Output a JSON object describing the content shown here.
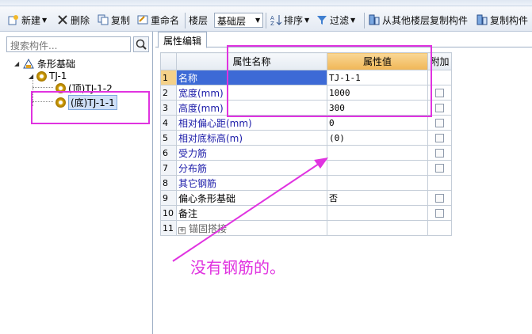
{
  "toolbar": {
    "new_label": "新建",
    "delete_label": "删除",
    "copy_label": "复制",
    "rename_label": "重命名",
    "floor_label": "楼层",
    "floor_value": "基础层",
    "sort_label": "排序",
    "filter_label": "过滤",
    "copy_from_floor_label": "从其他楼层复制构件",
    "copy_component_label": "复制构件"
  },
  "sidebar": {
    "search_placeholder": "搜索构件...",
    "tree": {
      "root_label": "条形基础",
      "group_label": "TJ-1",
      "children": [
        {
          "label": "(顶)TJ-1-2",
          "selected": false
        },
        {
          "label": "(底)TJ-1-1",
          "selected": true
        }
      ]
    }
  },
  "panel": {
    "tab_label": "属性编辑",
    "columns": {
      "name": "属性名称",
      "value": "属性值",
      "extra": "附加"
    },
    "rows": [
      {
        "num": "1",
        "name": "名称",
        "value": "TJ-1-1",
        "check": false
      },
      {
        "num": "2",
        "name": "宽度(mm)",
        "value": "1000",
        "check": true
      },
      {
        "num": "3",
        "name": "高度(mm)",
        "value": "300",
        "check": true
      },
      {
        "num": "4",
        "name": "相对偏心距(mm)",
        "value": "0",
        "check": true
      },
      {
        "num": "5",
        "name": "相对底标高(m)",
        "value": "(0)",
        "check": true
      },
      {
        "num": "6",
        "name": "受力筋",
        "value": "",
        "check": true
      },
      {
        "num": "7",
        "name": "分布筋",
        "value": "",
        "check": true
      },
      {
        "num": "8",
        "name": "其它钢筋",
        "value": "",
        "check": false
      },
      {
        "num": "9",
        "name": "偏心条形基础",
        "value": "否",
        "check": true
      },
      {
        "num": "10",
        "name": "备注",
        "value": "",
        "check": true
      },
      {
        "num": "11",
        "name": "锚固搭接",
        "value": "",
        "check": false
      }
    ]
  },
  "annotation": {
    "note_text": "没有钢筋的。",
    "color": "#e033e0"
  },
  "colors": {
    "selected_row": "#3d6ad6",
    "header_value_bg": "#f0b656",
    "name_text": "#1a1aa8"
  }
}
